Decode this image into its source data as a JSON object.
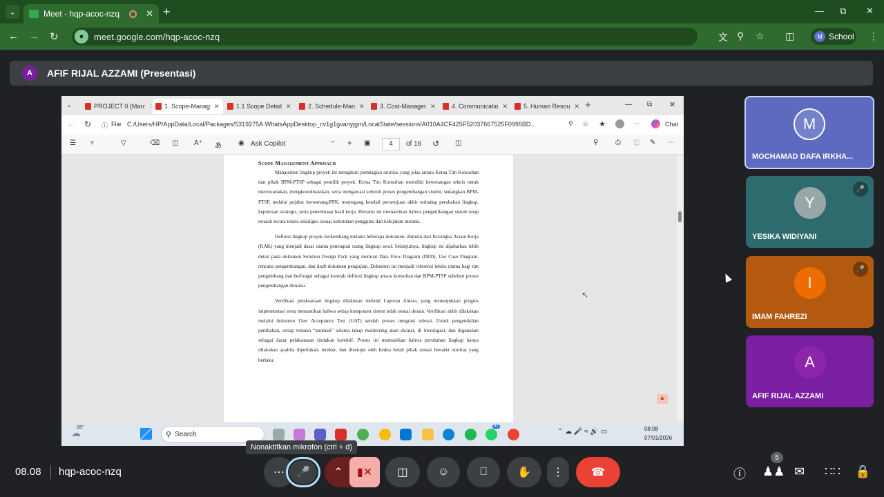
{
  "browser": {
    "tab_title": "Meet - hqp-acoc-nzq",
    "url": "meet.google.com/hqp-acoc-nzq",
    "profile_label": "School",
    "profile_initial": "M"
  },
  "presenter": {
    "initial": "A",
    "label": "AFIF RIJAL AZZAMI (Presentasi)"
  },
  "shared_screen": {
    "tabs": [
      "PROJECT 0 (Man:",
      "1. Scope-Manag",
      "1.1 Scope Detail",
      "2. Schedule-Man",
      "3. Cost-Manager",
      "4. Communicatio",
      "5. Human Resou"
    ],
    "file_label": "File",
    "path": "C:/Users/HP/AppData/Local/Packages/5319275A.WhatsAppDesktop_cv1g1gvanyjgm/LocalState/sessions/A010A4CF425F52037667525F0995BD...",
    "chat_label": "Chat",
    "copilot_label": "Ask Copilot",
    "page_number": "4",
    "page_total": "of 16",
    "doc": {
      "heading": "Scope Management Approach",
      "paragraphs": [
        "Manajemen lingkup proyek ini mengikuti pembagian otoritas yang jelas antara Ketua Tim Konsultan dan pihak BPM-PTSP sebagai pemilik proyek. Ketua Tim Konsultan memiliki kewenangan teknis untuk merencanakan, mengkoordinasikan, serta mengawasi seluruh proses pengembangan sistem, sedangkan BPM-PTSP, melalui pejabat berwenang/PPK, memegang kendali persetujuan akhir terhadap perubahan lingkup, keputusan strategis, serta penerimaan hasil kerja. Hierarki ini memastikan bahwa pengembangan sistem tetap terarah secara teknis sekaligus sesuai kebutuhan pengguna dan kebijakan instansi.",
        "Definisi lingkup proyek berkembang melalui beberapa dokumen, dimulai dari Kerangka Acuan Kerja (KAK) yang menjadi dasar utama penetapan ruang lingkup awal. Selanjutnya, lingkup ini dijabarkan lebih detail pada dokumen Solution Design Pack yang memuat Data Flow Diagram (DFD), Use Case Diagram, rencana pengembangan, dan draft dokumen pengujian. Dokumen ini menjadi referensi teknis utama bagi tim pengembang dan berfungsi sebagai kontrak definisi lingkup antara konsultan dan BPM-PTSP sebelum proses pengembangan dimulai.",
        "Verifikasi pelaksanaan lingkup dilakukan melalui Laporan Antara, yang menunjukkan progres implementasi serta memastikan bahwa setiap komponen sistem telah sesuai desain. Verifikasi akhir dilakukan melalui dokumen User Acceptance Test (UAT) setelah proses integrasi selesai. Untuk pengendalian perubahan, setiap temuan “anomali” selama tahap monitoring akan dicatat, di investigasi, dan digunakan sebagai dasar pelaksanaan tindakan korektif. Proses ini memastikan bahwa perubahan lingkup hanya dilakukan apabila diperlukan, terukur, dan disetujui oleh kedua belah pihak sesuai hierarki otoritas yang berlaku."
      ]
    },
    "taskbar": {
      "weather": "26°",
      "search_placeholder": "Search",
      "time": "08:08",
      "date": "07/01/2026",
      "whatsapp_badge": "91"
    }
  },
  "participants": [
    {
      "initial": "M",
      "name": "MOCHAMAD DAFA IRKHA...",
      "color": "#5c6bc0",
      "muted": false
    },
    {
      "initial": "Y",
      "name": "YESIKA WIDIYANI",
      "color": "#2e6b6e",
      "muted": true
    },
    {
      "initial": "I",
      "name": "IMAM FAHREZI",
      "color": "#b45a10",
      "muted": true
    },
    {
      "initial": "A",
      "name": "AFIF RIJAL AZZAMI",
      "color": "#7b1fa2",
      "muted": false
    }
  ],
  "meeting": {
    "time": "08.08",
    "code": "hqp-acoc-nzq",
    "mic_tooltip": "Nonaktifkan mikrofon (ctrl + d)",
    "people_count": "5"
  }
}
